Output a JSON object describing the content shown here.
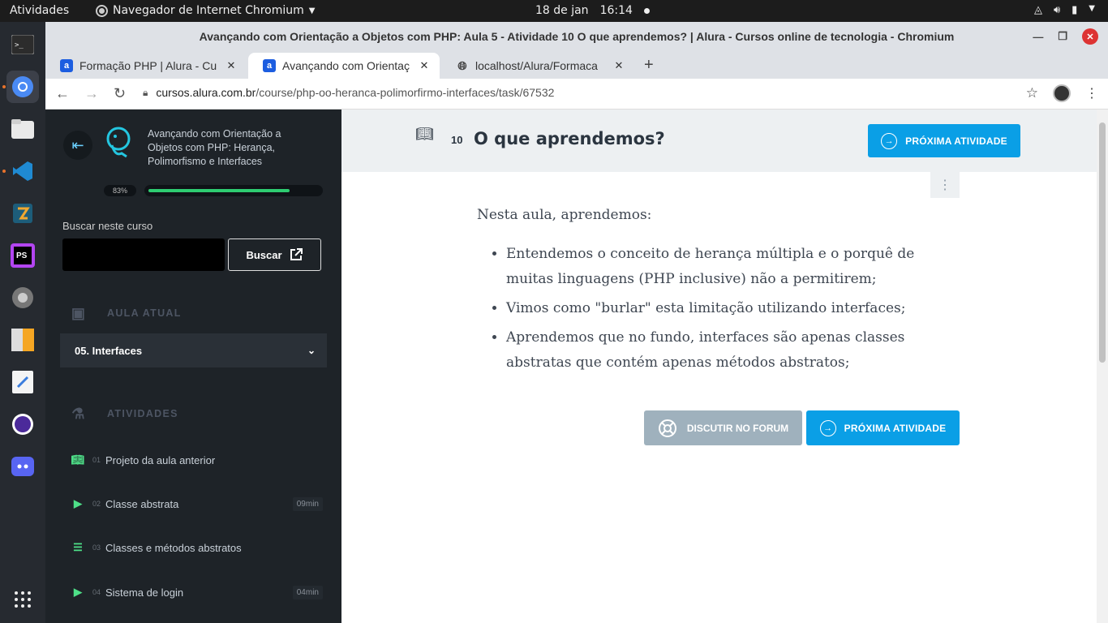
{
  "topbar": {
    "activities": "Atividades",
    "app_menu": "Navegador de Internet Chromium",
    "date": "18 de jan",
    "time": "16:14"
  },
  "window": {
    "title": "Avançando com Orientação a Objetos com PHP: Aula 5 - Atividade 10 O que aprendemos? | Alura - Cursos online de tecnologia - Chromium"
  },
  "tabs": [
    {
      "label": "Formação PHP | Alura - Cu",
      "favicon": "alura-icon"
    },
    {
      "label": "Avançando com Orientaç",
      "favicon": "alura-icon"
    },
    {
      "label": "localhost/Alura/Formaca",
      "favicon": "globe-icon"
    }
  ],
  "address": {
    "host": "cursos.alura.com.br",
    "path": "/course/php-oo-heranca-polimorfirmo-interfaces/task/67532"
  },
  "sidebar": {
    "course_title": "Avançando com Orientação a Objetos com PHP: Herança, Polimorfismo e Interfaces",
    "progress_label": "83%",
    "progress_value": 0.83,
    "search_label": "Buscar neste curso",
    "search_value": "",
    "search_button": "Buscar",
    "current_lesson_heading": "AULA ATUAL",
    "current_lesson": "05. Interfaces",
    "activities_heading": "ATIVIDADES",
    "activities": [
      {
        "num": "01",
        "name": "Projeto da aula anterior",
        "duration": "",
        "icon": "book-icon"
      },
      {
        "num": "02",
        "name": "Classe abstrata",
        "duration": "09min",
        "icon": "video-icon"
      },
      {
        "num": "03",
        "name": "Classes e métodos abstratos",
        "duration": "",
        "icon": "list-icon"
      },
      {
        "num": "04",
        "name": "Sistema de login",
        "duration": "04min",
        "icon": "video-icon"
      }
    ]
  },
  "main": {
    "number": "10",
    "title": "O que aprendemos?",
    "next_label": "PRÓXIMA ATIVIDADE",
    "forum_label": "DISCUTIR NO FORUM",
    "intro": "Nesta aula, aprendemos:",
    "bullets": [
      "Entendemos o conceito de herança múltipla e o porquê de muitas linguagens (PHP inclusive) não a permitirem;",
      "Vimos como \"burlar\" esta limitação utilizando interfaces;",
      "Aprendemos que no fundo, interfaces são apenas classes abstratas que contém apenas métodos abstratos;"
    ]
  },
  "colors": {
    "accent_blue": "#0a9fe6",
    "progress_green": "#2ecc71",
    "sidebar_bg": "#1e2328"
  }
}
